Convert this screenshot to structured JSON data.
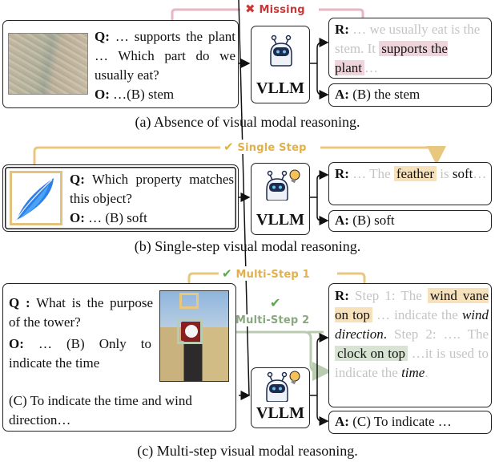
{
  "model_label": "VLLM",
  "panels": {
    "a": {
      "caption": "(a) Absence of visual modal reasoning.",
      "status_label": "Missing",
      "status_icon": "cross-icon",
      "status_color": "#c8383a",
      "line_color": "#e7b6c3",
      "image": "bamboo-shoot-photo",
      "question_prefix": "Q:",
      "question_text": "… supports the plant … Which part do we usually eat?",
      "options_prefix": "O:",
      "options_text": "…(B) stem",
      "reasoning_prefix": "R:",
      "reasoning_faded_1": "… we usually eat is the stem. It",
      "reasoning_highlight": "supports the plant",
      "reasoning_faded_2": "…",
      "answer_prefix": "A:",
      "answer_text": "(B) the stem"
    },
    "b": {
      "caption": "(b) Single-step visual modal reasoning.",
      "status_label": "Single Step",
      "status_icon": "check-icon",
      "status_color": "#e2b04a",
      "line_color": "#e8c77e",
      "image": "feather-image",
      "question_prefix": "Q:",
      "question_text": "Which property matches this object?",
      "options_prefix": "O:",
      "options_text": "… (B) soft",
      "reasoning_prefix": "R:",
      "reasoning_faded_1": "… The",
      "reasoning_highlight": "feather",
      "reasoning_faded_2": "is",
      "reasoning_plain": "soft",
      "reasoning_faded_3": "…",
      "answer_prefix": "A:",
      "answer_text": "(B) soft"
    },
    "c": {
      "caption": "(c) Multi-step visual modal reasoning.",
      "step1_label": "Multi-Step 1",
      "step1_color": "#e2b04a",
      "step1_line": "#e8c77e",
      "step2_label": "Multi-Step 2",
      "step2_color": "#8aa87f",
      "step2_line": "#b9cbb1",
      "check_color": "#5aa84a",
      "image": "clock-tower-photo",
      "question_prefix": "Q :",
      "question_text": "What is the purpose of the tower?",
      "options_prefix": "O:",
      "options_text_1": "… (B) Only to indicate the time",
      "options_text_2": "(C) To indicate the time and wind direction…",
      "reasoning_prefix": "R:",
      "r_faded_1": "Step 1: The",
      "r_hl_1": "wind vane on top",
      "r_faded_2": "… indicate the",
      "r_italic_1": "wind direction",
      "r_dot": ".",
      "r_faded_3": "Step 2: …. The",
      "r_hl_2": "clock on top",
      "r_faded_4": "…it is used to indicate the",
      "r_italic_2": "time",
      "answer_prefix": "A:",
      "answer_text": "(C) To indicate …"
    }
  }
}
